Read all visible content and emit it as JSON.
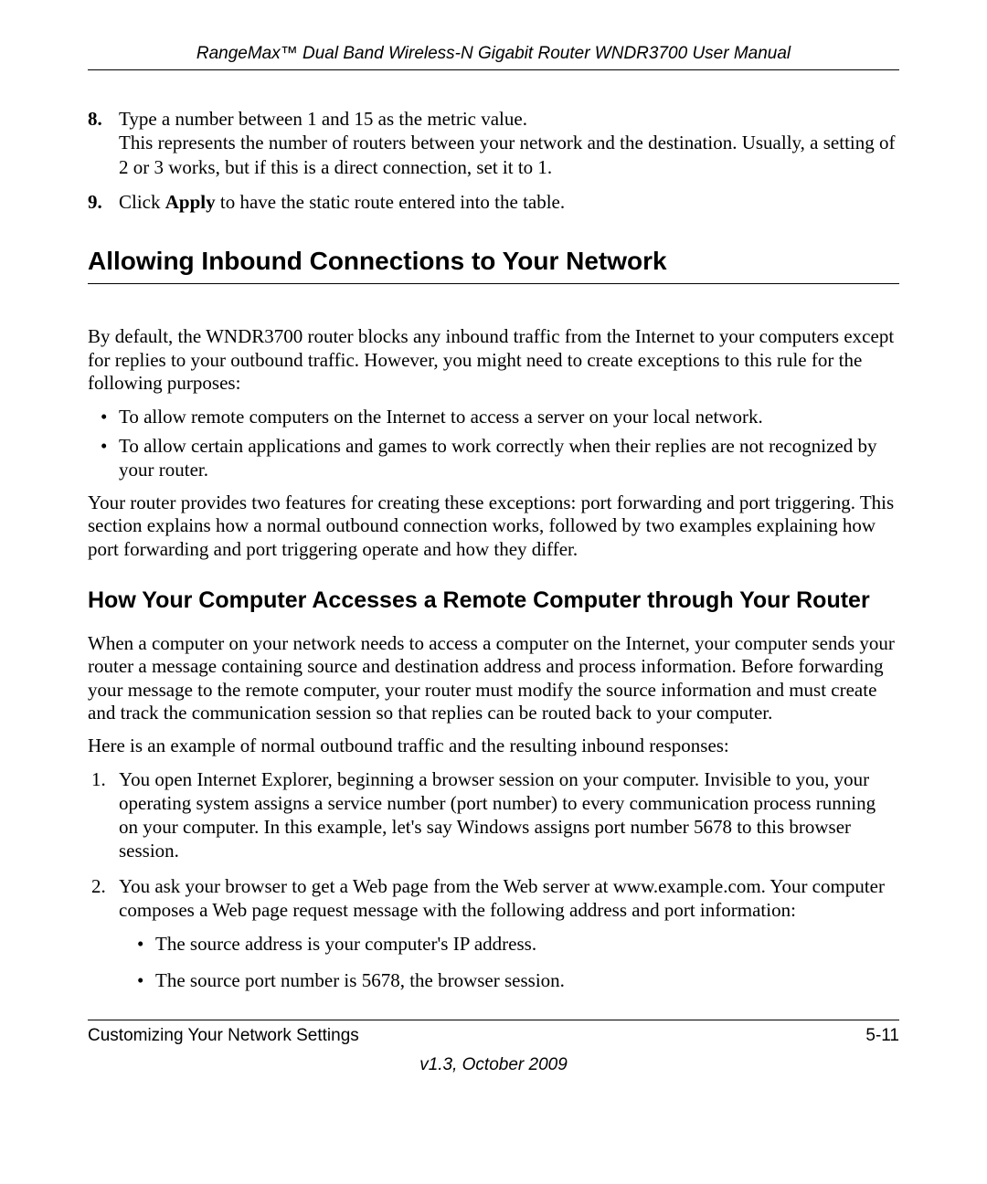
{
  "header": {
    "title": "RangeMax™ Dual Band Wireless-N Gigabit Router WNDR3700 User Manual"
  },
  "steps": [
    {
      "num": "8.",
      "text_before": "Type a number between 1 and 15 as the metric value.",
      "text_after": "This represents the number of routers between your network and the destination. Usually, a setting of 2 or 3 works, but if this is a direct connection, set it to 1."
    },
    {
      "num": "9.",
      "click_word": "Click ",
      "bold_word": "Apply",
      "rest": " to have the static route entered into the table."
    }
  ],
  "section": {
    "title": "Allowing Inbound Connections to Your Network",
    "intro": "By default, the WNDR3700 router blocks any inbound traffic from the Internet to your computers except for replies to your outbound traffic. However, you might need to create exceptions to this rule for the following purposes:",
    "bullets": [
      "To allow remote computers on the Internet to access a server on your local network.",
      "To allow certain applications and games to work correctly when their replies are not recognized by your router."
    ],
    "after_bullets": "Your router provides two features for creating these exceptions: port forwarding and port triggering. This section explains how a normal outbound connection works, followed by two examples explaining how port forwarding and port triggering operate and how they differ."
  },
  "subsection": {
    "title": "How Your Computer Accesses a Remote Computer through Your Router",
    "para1": "When a computer on your network needs to access a computer on the Internet, your computer sends your router a message containing source and destination address and process information. Before forwarding your message to the remote computer, your router must modify the source information and must create and track the communication session so that replies can be routed back to your computer.",
    "para2": "Here is an example of normal outbound traffic and the resulting inbound responses:",
    "list": [
      {
        "text": "You open Internet Explorer, beginning a browser session on your computer. Invisible to you, your operating system assigns a service number (port number) to every communication process running on your computer. In this example, let's say Windows assigns port number 5678 to this browser session."
      },
      {
        "text": "You ask your browser to get a Web page from the Web server at www.example.com. Your computer composes a Web page request message with the following address and port information:",
        "sub": [
          "The source address is your computer's IP address.",
          "The source port number is 5678, the browser session."
        ]
      }
    ]
  },
  "footer": {
    "left": "Customizing Your Network Settings",
    "right": "5-11",
    "version": "v1.3, October 2009"
  }
}
